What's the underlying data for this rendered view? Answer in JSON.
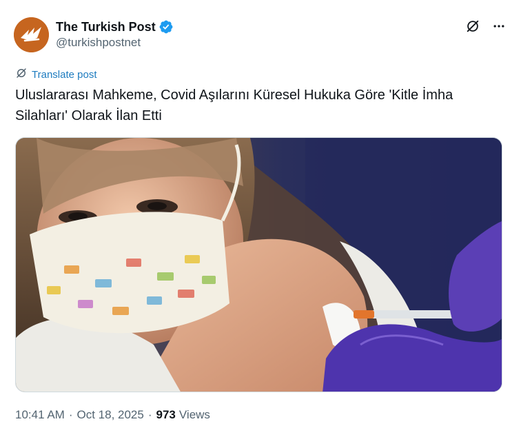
{
  "account": {
    "display_name": "The Turkish Post",
    "handle": "@turkishpostnet",
    "verified": true,
    "avatar_color": "#c6651f",
    "verified_color": "#1d9bf0"
  },
  "actions": {
    "grok_icon": "grok-icon",
    "more_icon": "more-options-icon"
  },
  "translate": {
    "label": "Translate post",
    "color": "#1d7bbf"
  },
  "post": {
    "text": "Uluslararası Mahkeme, Covid Aşılarını Küresel Hukuka Göre 'Kitle İmha Silahları' Olarak İlan Etti"
  },
  "media": {
    "description_icon": "photo"
  },
  "meta": {
    "time": "10:41 AM",
    "date": "Oct 18, 2025",
    "views_count": "973",
    "views_label": "Views",
    "separator": "·"
  }
}
